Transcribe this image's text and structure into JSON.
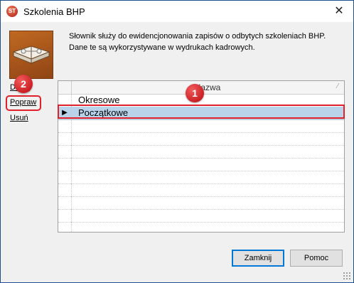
{
  "window": {
    "title": "Szkolenia BHP",
    "app_icon_text": "ST",
    "close_glyph": "✕"
  },
  "header": {
    "description": "Słownik służy do ewidencjonowania zapisów o odbytych szkoleniach BHP. Dane te są wykorzystywane w wydrukach kadrowych."
  },
  "side_actions": {
    "dodaj": "Dodaj",
    "popraw": "Popraw",
    "usun": "Usuń"
  },
  "grid": {
    "column_header": "Nazwa",
    "sort_mark": "⁄",
    "current_row_glyph": "▶",
    "rows": [
      {
        "name": "Okresowe",
        "selected": false
      },
      {
        "name": "Początkowe",
        "selected": true
      }
    ]
  },
  "annotations": {
    "badge1": "1",
    "badge2": "2",
    "highlight_color": "#e0202a"
  },
  "buttons": {
    "close": "Zamknij",
    "help": "Pomoc"
  },
  "colors": {
    "selected_row": "#b9d3ea",
    "window_border": "#1f4f8c"
  }
}
